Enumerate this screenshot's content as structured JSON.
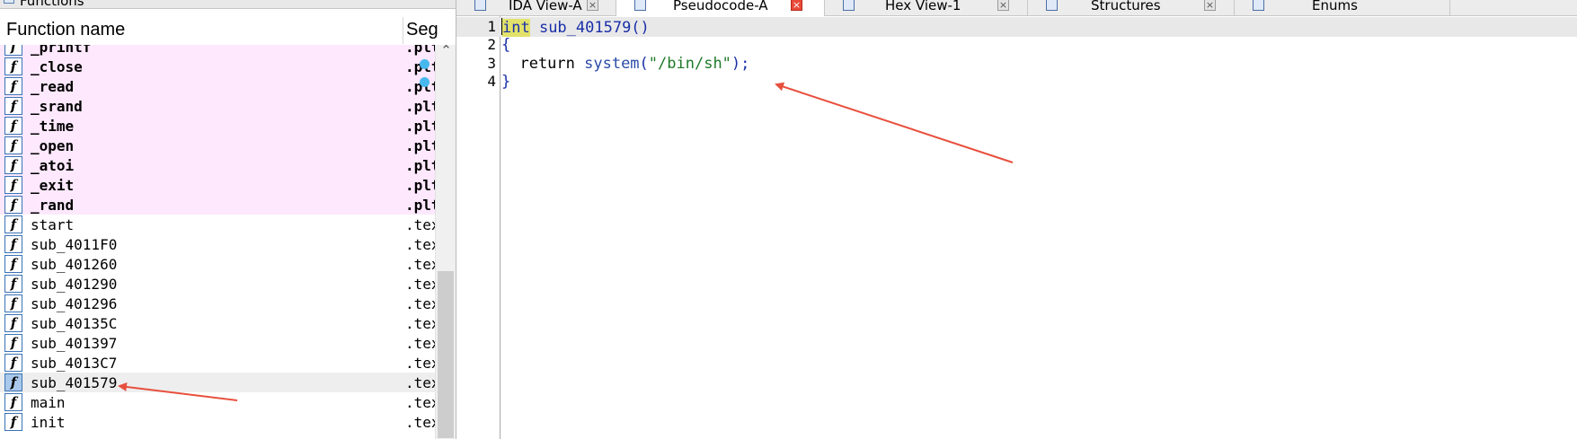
{
  "functions_pane": {
    "title": "Functions",
    "header": {
      "name": "Function name",
      "segment": "Seg"
    },
    "rows": [
      {
        "name": "_printf",
        "seg": ".plt",
        "kind": "plt"
      },
      {
        "name": "_close",
        "seg": ".plt",
        "kind": "plt"
      },
      {
        "name": "_read",
        "seg": ".plt",
        "kind": "plt"
      },
      {
        "name": "_srand",
        "seg": ".plt",
        "kind": "plt"
      },
      {
        "name": "_time",
        "seg": ".plt",
        "kind": "plt"
      },
      {
        "name": "_open",
        "seg": ".plt",
        "kind": "plt"
      },
      {
        "name": "_atoi",
        "seg": ".plt",
        "kind": "plt"
      },
      {
        "name": "_exit",
        "seg": ".plt",
        "kind": "plt"
      },
      {
        "name": "_rand",
        "seg": ".plt",
        "kind": "plt"
      },
      {
        "name": "start",
        "seg": ".text",
        "kind": "text"
      },
      {
        "name": "sub_4011F0",
        "seg": ".text",
        "kind": "text"
      },
      {
        "name": "sub_401260",
        "seg": ".text",
        "kind": "text"
      },
      {
        "name": "sub_401290",
        "seg": ".text",
        "kind": "text"
      },
      {
        "name": "sub_401296",
        "seg": ".text",
        "kind": "text"
      },
      {
        "name": "sub_40135C",
        "seg": ".text",
        "kind": "text"
      },
      {
        "name": "sub_401397",
        "seg": ".text",
        "kind": "text"
      },
      {
        "name": "sub_4013C7",
        "seg": ".text",
        "kind": "text"
      },
      {
        "name": "sub_401579",
        "seg": ".text",
        "kind": "selected"
      },
      {
        "name": "main",
        "seg": ".text",
        "kind": "text"
      },
      {
        "name": "init",
        "seg": ".text",
        "kind": "text"
      }
    ],
    "icon_glyph": "f"
  },
  "tabs": [
    {
      "label": "IDA View-A",
      "active": false,
      "icon": "ida-view-icon"
    },
    {
      "label": "Pseudocode-A",
      "active": true,
      "icon": "pseudocode-icon"
    },
    {
      "label": "Hex View-1",
      "active": false,
      "icon": "hex-view-icon"
    },
    {
      "label": "Structures",
      "active": false,
      "icon": "structures-icon"
    },
    {
      "label": "Enums",
      "active": false,
      "icon": "enums-icon"
    }
  ],
  "tab_close_glyph": "×",
  "pseudocode": {
    "line_numbers": [
      "1",
      "2",
      "3",
      "4"
    ],
    "lines": {
      "l1_type": "int",
      "l1_rest": " sub_401579()",
      "l2": "{",
      "l3_kw": "  return ",
      "l3_fn": "system",
      "l3_open": "(",
      "l3_str": "\"/bin/sh\"",
      "l3_close": ");",
      "l4": "}"
    },
    "breakpoint_lines": [
      "3",
      "4"
    ]
  },
  "colors": {
    "plt_row_bg": "#fde8fd",
    "annotation_arrow": "#e8503e",
    "breakpoint_dot": "#47b8ee",
    "keyword_highlight": "#e2e26a"
  }
}
